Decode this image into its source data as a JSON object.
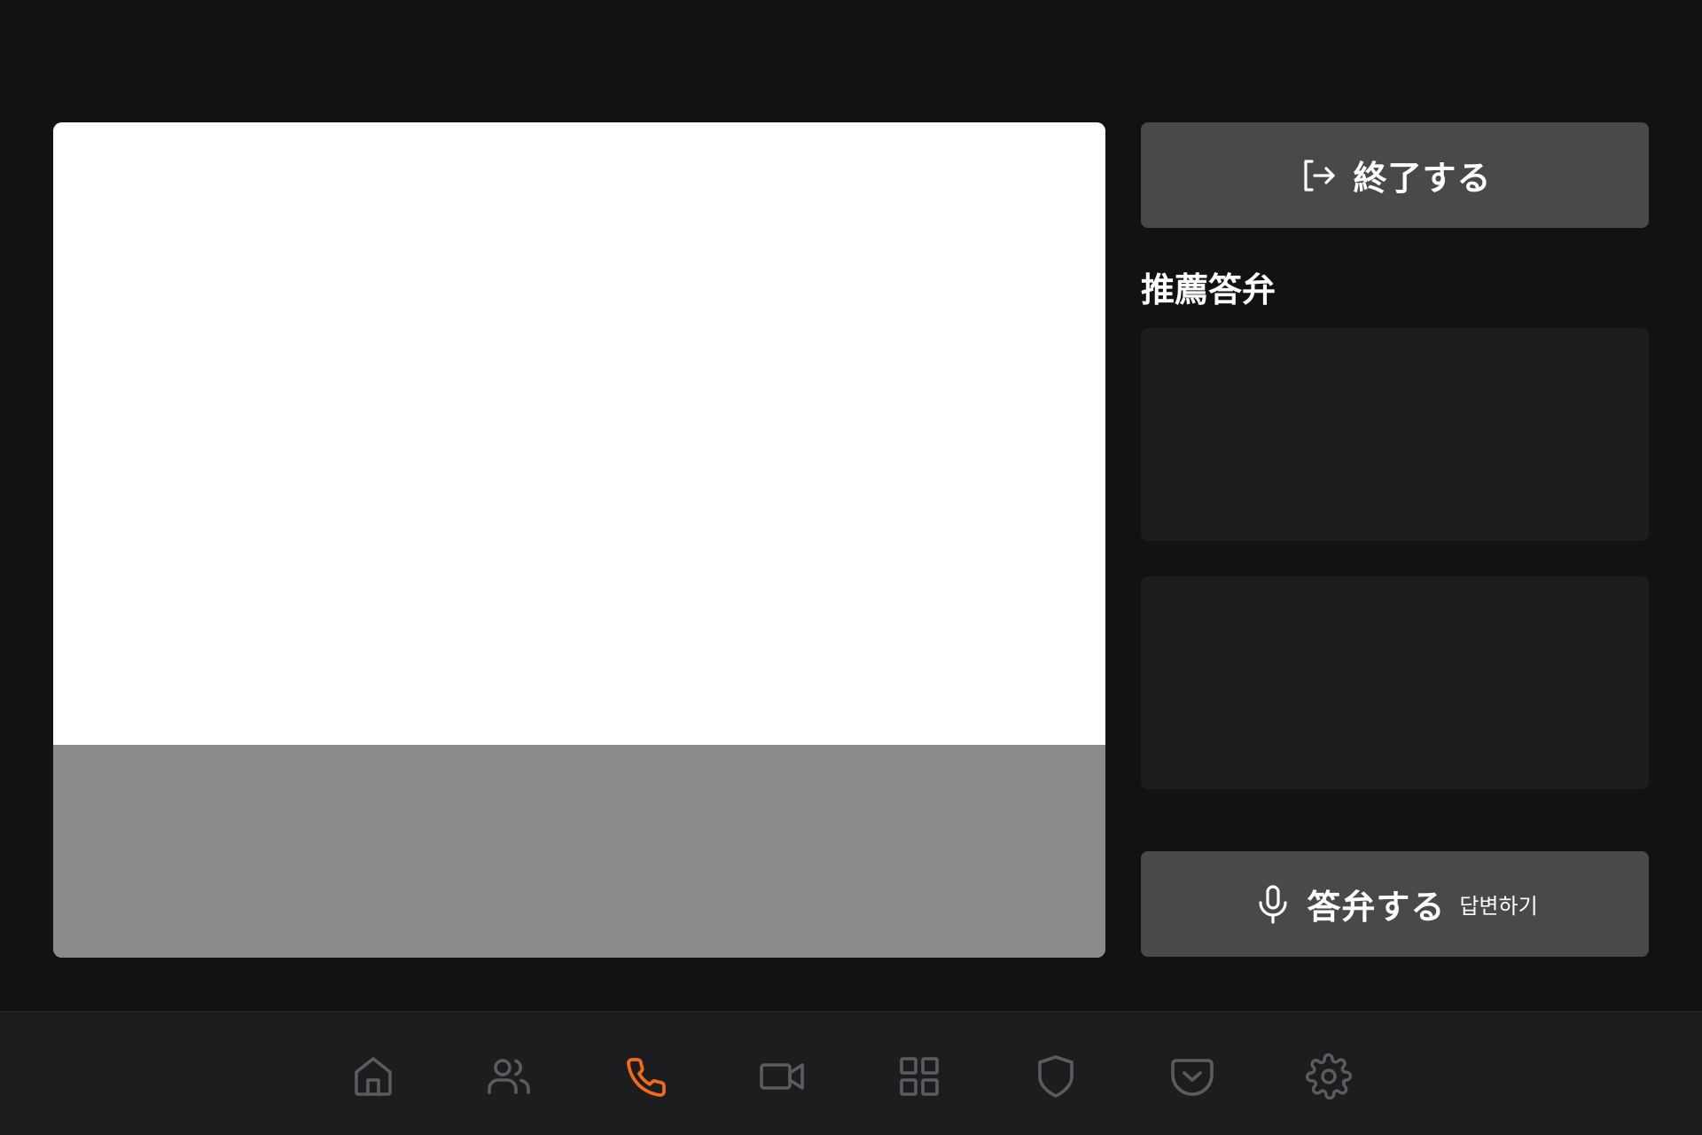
{
  "side": {
    "end_button": {
      "label": "終了する",
      "icon": "sign-out-icon"
    },
    "recommended_title": "推薦答弁",
    "answer_button": {
      "label": "答弁する",
      "sub_label": "답변하기",
      "icon": "microphone-icon"
    }
  },
  "bottom_nav": {
    "items": [
      {
        "icon": "home-icon",
        "active": false
      },
      {
        "icon": "users-icon",
        "active": false
      },
      {
        "icon": "phone-icon",
        "active": true
      },
      {
        "icon": "video-camera-icon",
        "active": false
      },
      {
        "icon": "grid-icon",
        "active": false
      },
      {
        "icon": "shield-icon",
        "active": false
      },
      {
        "icon": "pocket-icon",
        "active": false
      },
      {
        "icon": "gear-icon",
        "active": false
      }
    ]
  },
  "colors": {
    "background": "#111214",
    "button": "#48494b",
    "card": "#1c1d1f",
    "nav_bar": "#1c1d1f",
    "nav_icon": "#5b5c5f",
    "nav_active": "#f26b1d",
    "video_main": "#ffffff",
    "video_caption": "#898a8c"
  }
}
